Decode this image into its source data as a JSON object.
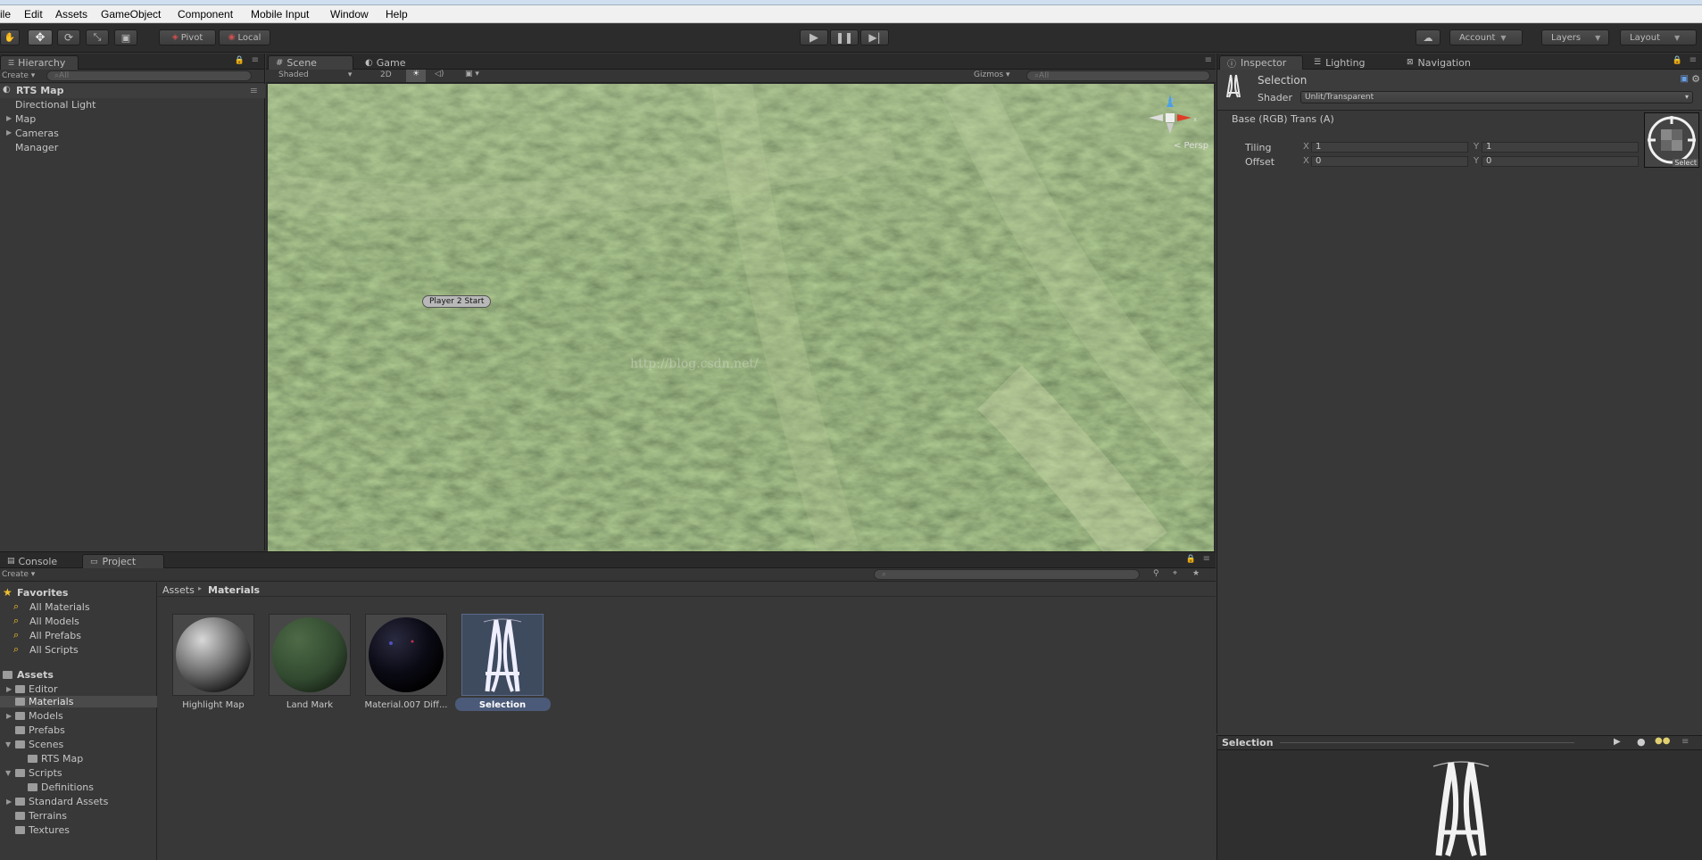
{
  "menu": {
    "items": [
      "ile",
      "Edit",
      "Assets",
      "GameObject",
      "Component",
      "Mobile Input",
      "Window",
      "Help"
    ]
  },
  "toolbar": {
    "pivot_label": "Pivot",
    "local_label": "Local",
    "account_label": "Account",
    "layers_label": "Layers",
    "layout_label": "Layout",
    "transform_tools": [
      "hand-icon",
      "move-icon",
      "rotate-icon",
      "scale-icon",
      "rect-tool-icon"
    ],
    "play_icons": [
      "play-icon",
      "pause-icon",
      "step-icon"
    ]
  },
  "hierarchy": {
    "tab_label": "Hierarchy",
    "create_label": "Create",
    "search_placeholder": "All",
    "scene_name": "RTS Map",
    "items": [
      "Directional Light",
      "Map",
      "Cameras",
      "Manager"
    ]
  },
  "scene": {
    "tab_scene": "Scene",
    "tab_game": "Game",
    "shading_mode": "Shaded",
    "mode_2d": "2D",
    "gizmos_label": "Gizmos",
    "search_placeholder": "All",
    "persp_label": "< Persp",
    "player_label": "Player 2 Start",
    "watermark": "http://blog.csdn.net/",
    "terrain_color": "#4d6638"
  },
  "project": {
    "tab_console": "Console",
    "tab_project": "Project",
    "create_label": "Create",
    "favorites_label": "Favorites",
    "favorites": [
      "All Materials",
      "All Models",
      "All Prefabs",
      "All Scripts"
    ],
    "assets_label": "Assets",
    "folders": [
      {
        "label": "Editor",
        "level": 1
      },
      {
        "label": "Materials",
        "level": 1
      },
      {
        "label": "Models",
        "level": 1
      },
      {
        "label": "Prefabs",
        "level": 1
      },
      {
        "label": "Scenes",
        "level": 1
      },
      {
        "label": "RTS Map",
        "level": 2
      },
      {
        "label": "Scripts",
        "level": 1
      },
      {
        "label": "Definitions",
        "level": 2
      },
      {
        "label": "Standard Assets",
        "level": 1
      },
      {
        "label": "Terrains",
        "level": 1
      },
      {
        "label": "Textures",
        "level": 1
      }
    ],
    "breadcrumb_root": "Assets",
    "breadcrumb_current": "Materials",
    "assets": [
      {
        "label": "Highlight Map",
        "kind": "grey-sphere"
      },
      {
        "label": "Land Mark",
        "kind": "green-sphere"
      },
      {
        "label": "Material.007 Diff...",
        "kind": "dark-sphere"
      },
      {
        "label": "Selection",
        "kind": "selection-texture"
      }
    ]
  },
  "inspector": {
    "tab_inspector": "Inspector",
    "tab_lighting": "Lighting",
    "tab_navigation": "Navigation",
    "material_name": "Selection",
    "shader_label": "Shader",
    "shader_value": "Unlit/Transparent",
    "property_label": "Base (RGB) Trans (A)",
    "tiling_label": "Tiling",
    "offset_label": "Offset",
    "x_label": "X",
    "y_label": "Y",
    "tiling_x": "1",
    "tiling_y": "1",
    "offset_x": "0",
    "offset_y": "0",
    "select_label": "Select",
    "preview_title": "Selection"
  }
}
